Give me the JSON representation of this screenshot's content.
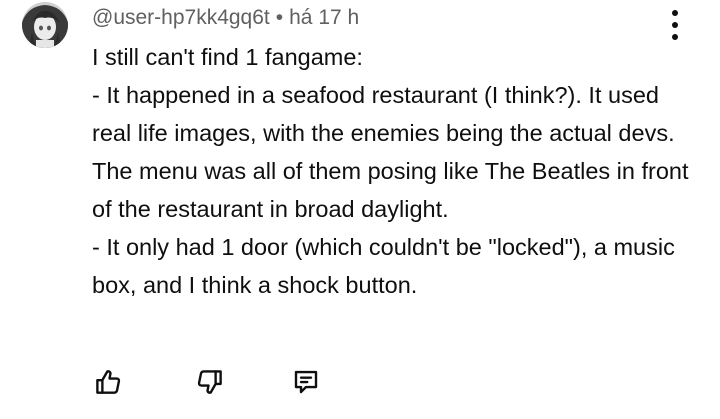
{
  "comment": {
    "author": "@user-hp7kk4gq6t",
    "separator": "•",
    "time": "há 17 h",
    "paragraphs": [
      "I still can't find 1 fangame:",
      "- It happened in a seafood restaurant (I think?). It used real life images, with the enemies being the actual devs. The menu was all of them posing like The Beatles in front of the restaurant in broad daylight.",
      "- It only had 1 door (which couldn't be \"locked\"), a music box, and I think a shock button."
    ]
  },
  "icons": {
    "avatar": "avatar-image",
    "menu": "more-vert-icon",
    "like": "thumb-up-icon",
    "dislike": "thumb-down-icon",
    "reply": "comment-reply-icon"
  },
  "colors": {
    "text": "#0f0f0f",
    "meta": "#606060",
    "background": "#ffffff"
  }
}
